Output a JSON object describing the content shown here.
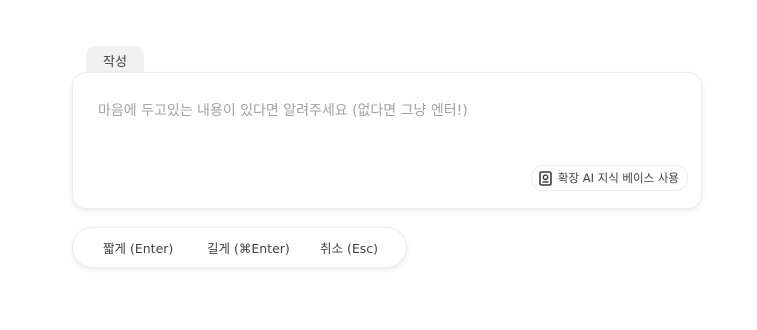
{
  "compose_tab": {
    "label": "작성"
  },
  "composer": {
    "placeholder": "마음에 두고있는 내용이 있다면 알려주세요 (없다면 그냥 엔터!)",
    "value": ""
  },
  "knowledge_toggle": {
    "icon": "book-icon",
    "label": "확장 AI 지식 베이스 사용"
  },
  "actions": {
    "short_label": "짧게 (Enter)",
    "long_label": "길게 (⌘Enter)",
    "cancel_label": "취소 (Esc)"
  }
}
